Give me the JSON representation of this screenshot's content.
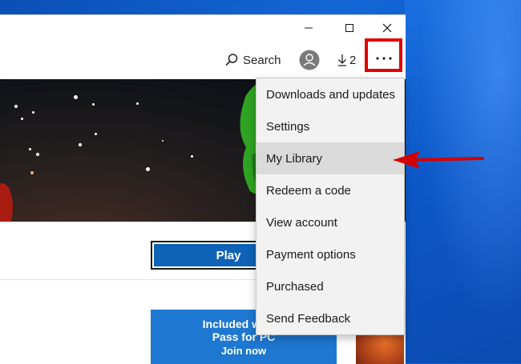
{
  "toolbar": {
    "search_label": "Search",
    "downloads_count": "2"
  },
  "window_controls": {
    "minimize": "minimize",
    "maximize": "maximize",
    "close": "close"
  },
  "hero": {
    "play_label": "Play"
  },
  "promo": {
    "line1": "Included with X",
    "line2": "Pass for PC",
    "line3": "Join now"
  },
  "menu": {
    "items": [
      {
        "label": "Downloads and updates"
      },
      {
        "label": "Settings"
      },
      {
        "label": "My Library"
      },
      {
        "label": "Redeem a code"
      },
      {
        "label": "View account"
      },
      {
        "label": "Payment options"
      },
      {
        "label": "Purchased"
      },
      {
        "label": "Send Feedback"
      }
    ],
    "hovered_index": 2
  },
  "colors": {
    "accent": "#0e62b8",
    "highlight": "#e00000",
    "promo": "#1e77d0",
    "desktop": "#0b56c4"
  }
}
